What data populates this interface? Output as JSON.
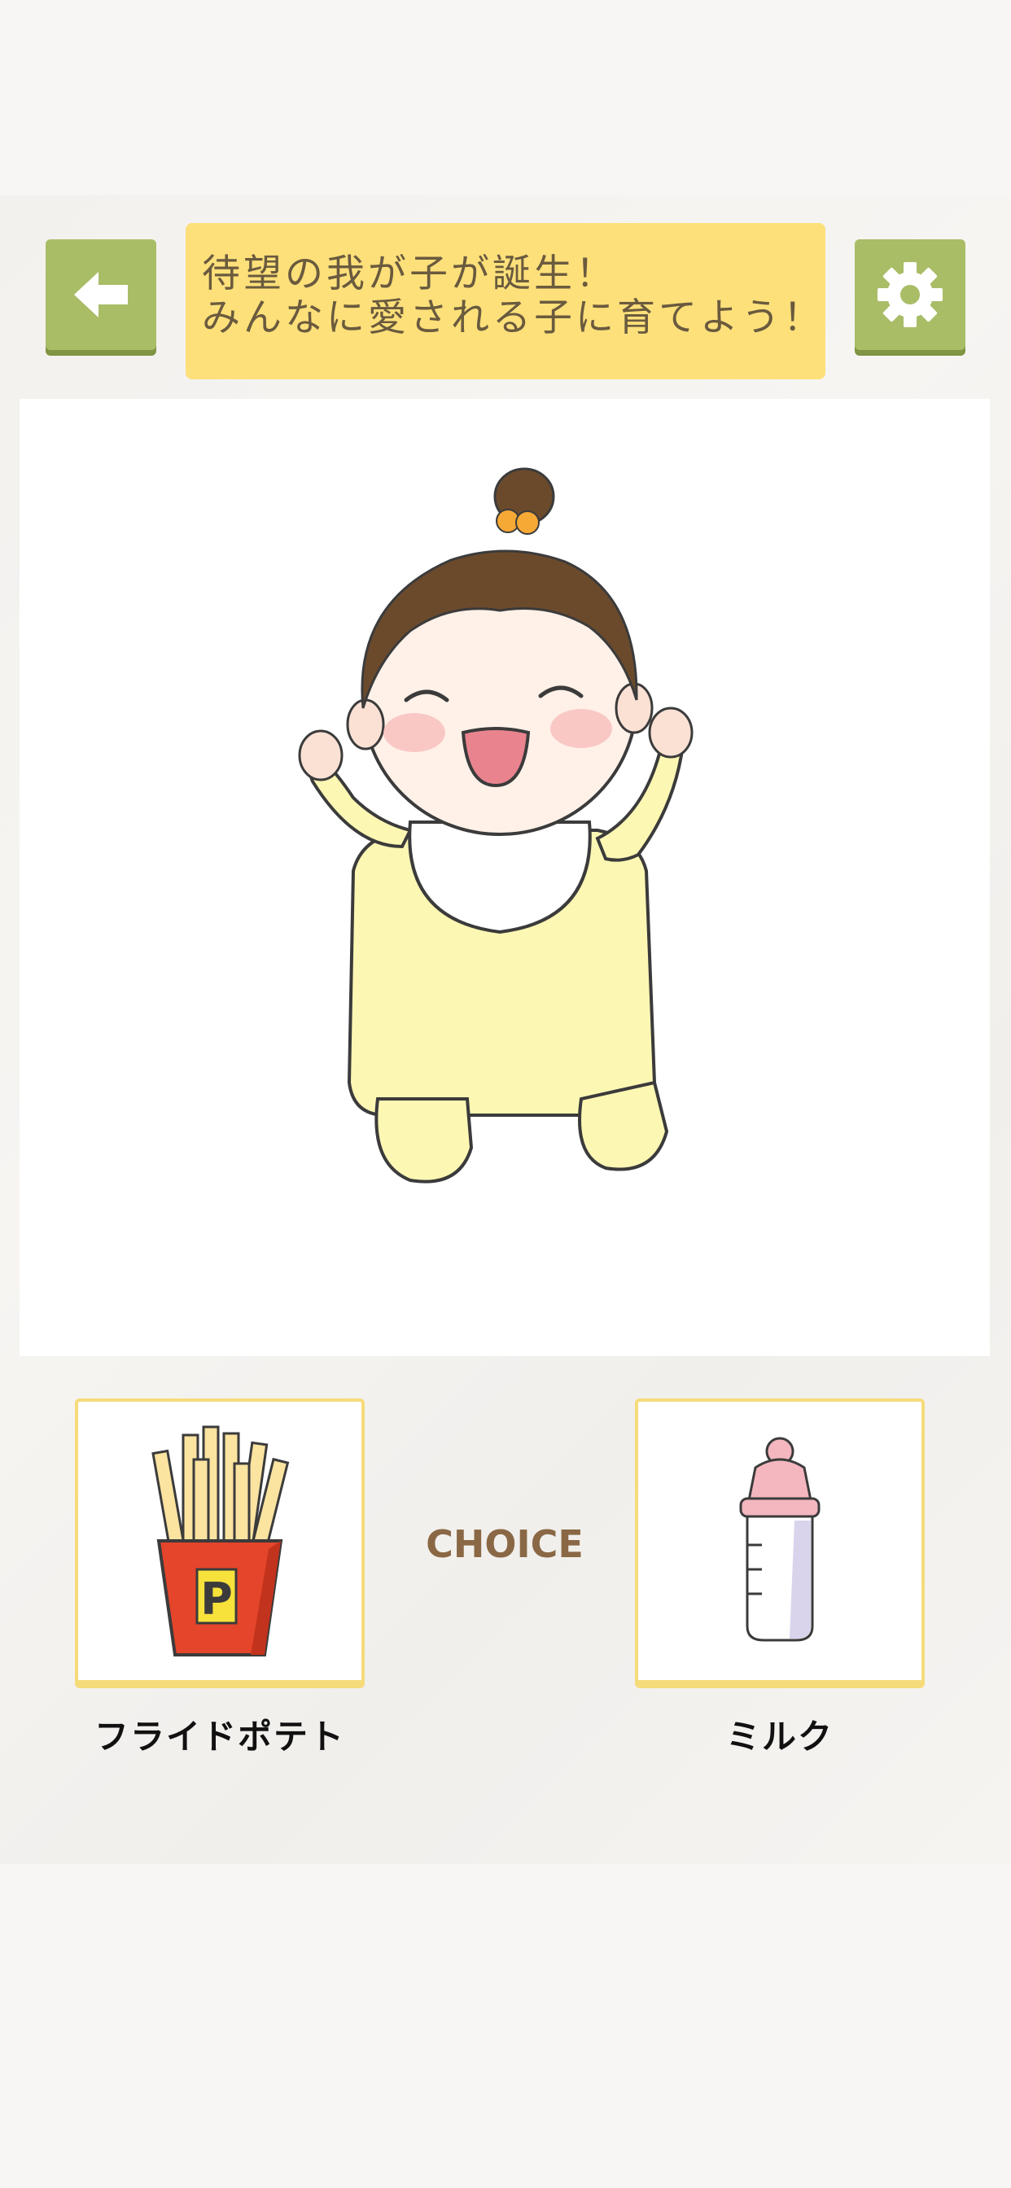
{
  "header": {
    "back_icon": "arrow-left-icon",
    "settings_icon": "gear-icon",
    "message_line1": "待望の我が子が誕生！",
    "message_line2": "みんなに愛される子に育てよう！"
  },
  "stage": {
    "character": "baby-in-yellow-onesie"
  },
  "choices": {
    "center_label": "CHOICE",
    "left": {
      "label": "フライドポテト",
      "icon": "french-fries-icon",
      "badge": "P"
    },
    "right": {
      "label": "ミルク",
      "icon": "baby-bottle-icon"
    }
  },
  "colors": {
    "button_green": "#a9bd67",
    "message_yellow": "#fde07a",
    "card_border": "#f6db7a",
    "choice_brown": "#8a6845"
  }
}
